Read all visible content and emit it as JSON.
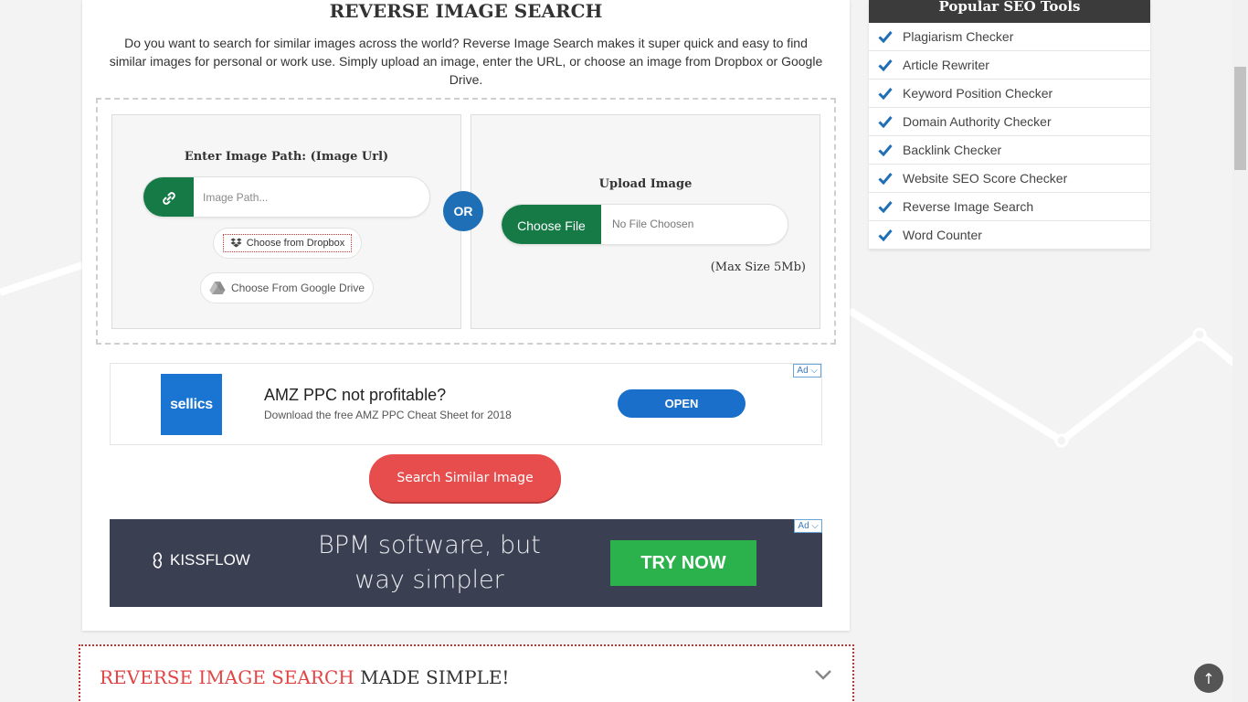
{
  "main": {
    "title": "REVERSE IMAGE SEARCH",
    "intro": "Do you want to search for similar images across the world? Reverse Image Search makes it super quick and easy to find similar images for personal or work use. Simply upload an image, enter the URL, or choose an image from Dropbox or Google Drive.",
    "url_panel": {
      "title": "Enter Image Path: (Image Url)",
      "placeholder": "Image Path...",
      "dropbox_label": "Choose from Dropbox",
      "gdrive_label": "Choose From Google Drive"
    },
    "or_label": "OR",
    "upload_panel": {
      "title": "Upload Image",
      "choose_file_label": "Choose File",
      "no_file_label": "No File Choosen",
      "max_size": "(Max Size 5Mb)"
    },
    "search_button": "Search Similar Image"
  },
  "ad1": {
    "tag": "Ad",
    "logo": "sellics",
    "headline": "AMZ PPC not profitable?",
    "subline": "Download the free AMZ PPC Cheat Sheet for 2018",
    "cta": "OPEN"
  },
  "ad2": {
    "tag": "Ad",
    "logo": "KISSFLOW",
    "line1": "BPM software, but",
    "line2": "way simpler",
    "cta": "TRY NOW"
  },
  "accordion": {
    "title_highlight": "REVERSE IMAGE SEARCH",
    "title_rest": " MADE SIMPLE!"
  },
  "sidebar": {
    "heading": "Popular SEO Tools",
    "items": [
      {
        "label": "Plagiarism Checker"
      },
      {
        "label": "Article Rewriter"
      },
      {
        "label": "Keyword Position Checker"
      },
      {
        "label": "Domain Authority Checker"
      },
      {
        "label": "Backlink Checker"
      },
      {
        "label": "Website SEO Score Checker"
      },
      {
        "label": "Reverse Image Search"
      },
      {
        "label": "Word Counter"
      }
    ]
  },
  "back_to_top": "↑",
  "colors": {
    "green": "#157a46",
    "blue": "#1f6fb6",
    "red": "#e84d4d",
    "check_blue": "#1f6fb6"
  }
}
